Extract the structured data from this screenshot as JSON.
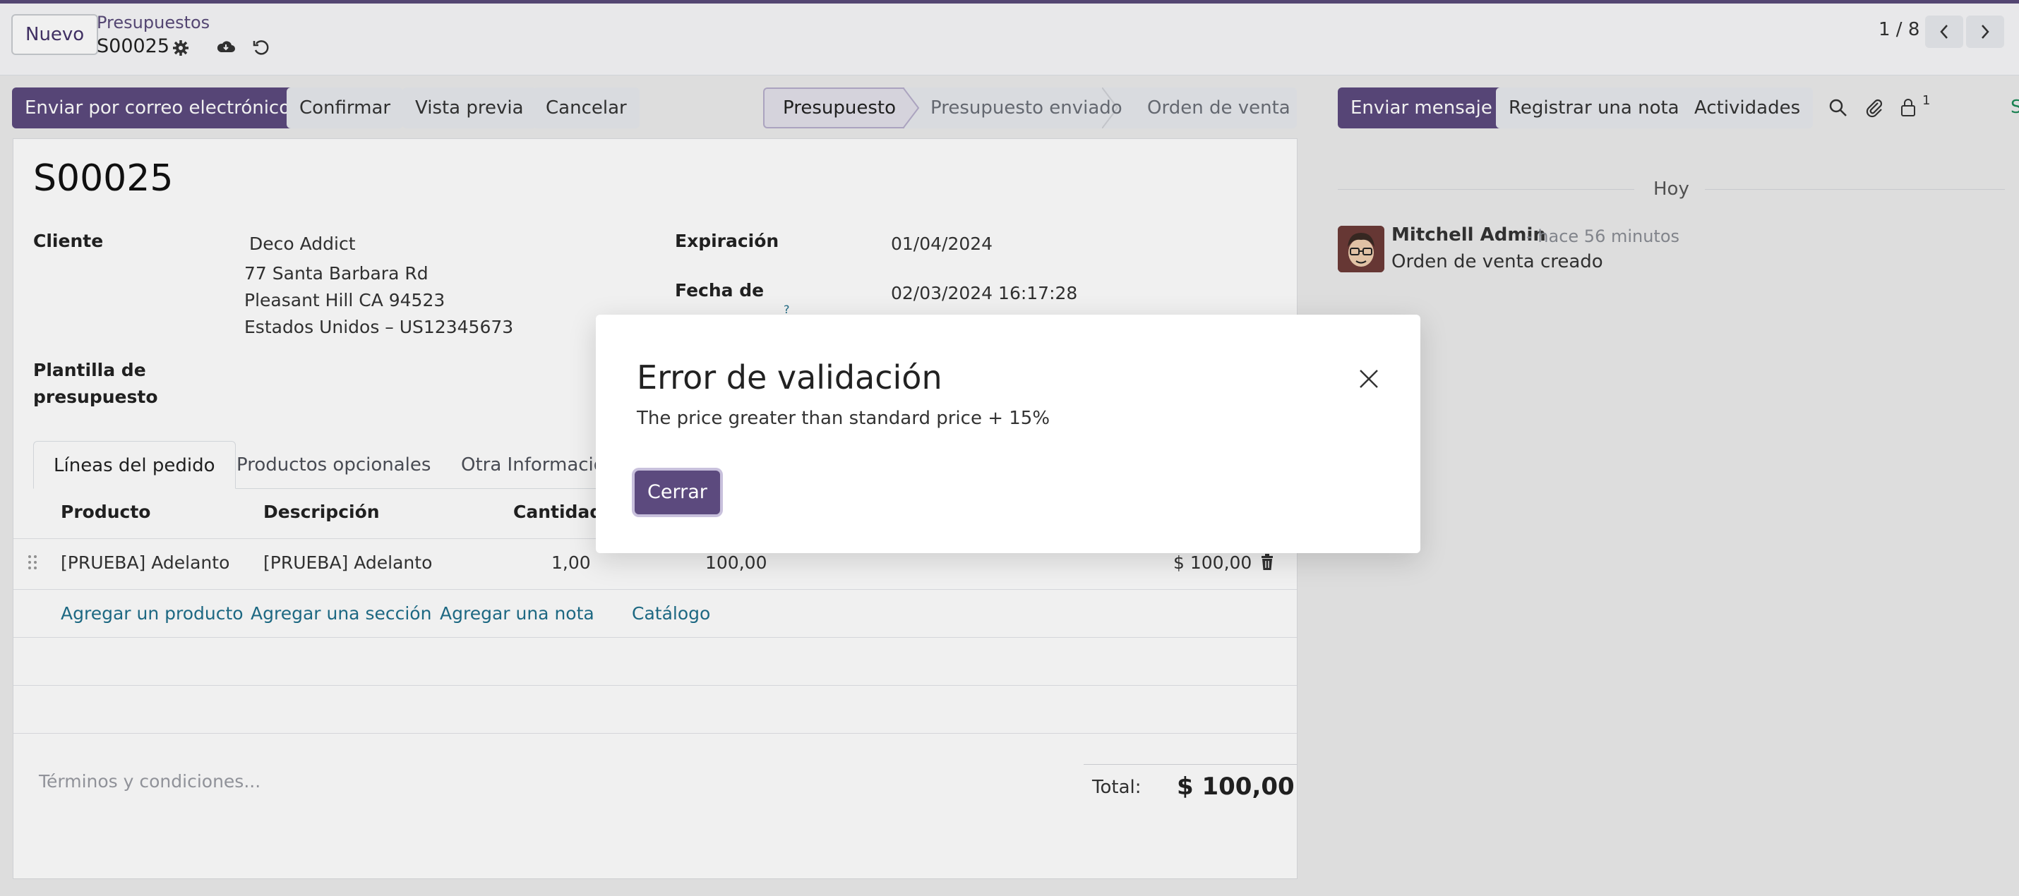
{
  "control_panel": {
    "new_button": "Nuevo",
    "breadcrumb_parent": "Presupuestos",
    "breadcrumb_current": "S00025",
    "pager": "1 / 8"
  },
  "actions": {
    "send_email": "Enviar por correo electrónico",
    "confirm": "Confirmar",
    "preview": "Vista previa",
    "cancel": "Cancelar"
  },
  "status": {
    "steps": [
      "Presupuesto",
      "Presupuesto enviado",
      "Orden de venta"
    ],
    "active": "Presupuesto"
  },
  "form": {
    "title": "S00025",
    "customer_label": "Cliente",
    "customer_name": "Deco Addict",
    "customer_address_1": "77 Santa Barbara Rd",
    "customer_address_2": "Pleasant Hill CA 94523",
    "customer_address_3": "Estados Unidos – US12345673",
    "template_label_1": "Plantilla de",
    "template_label_2": "presupuesto",
    "expiration_label": "Expiración",
    "expiration_value": "01/04/2024",
    "date_label": "Fecha de",
    "date_value": "02/03/2024 16:17:28",
    "help_mark": "?"
  },
  "tabs": [
    "Líneas del pedido",
    "Productos opcionales",
    "Otra Información"
  ],
  "table": {
    "headers": [
      "Producto",
      "Descripción",
      "Cantidad"
    ],
    "rows": [
      {
        "product": "[PRUEBA] Adelanto",
        "description": "[PRUEBA] Adelanto",
        "quantity": "1,00",
        "price": "100,00",
        "subtotal": "$ 100,00"
      }
    ],
    "add_links": [
      "Agregar un producto",
      "Agregar una sección",
      "Agregar una nota",
      "Catálogo"
    ]
  },
  "footer": {
    "terms_placeholder": "Términos y condiciones...",
    "total_label": "Total:",
    "total_value": "$ 100,00"
  },
  "chatter": {
    "send_message": "Enviar mensaje",
    "log_note": "Registrar una nota",
    "activities": "Actividades",
    "followers_count": "1",
    "today": "Hoy",
    "author": "Mitchell Admin",
    "time_ago": "- hace 56 minutos",
    "message": "Orden de venta creado"
  },
  "modal": {
    "title": "Error de validación",
    "body": "The price greater than standard price + 15%",
    "close_button": "Cerrar"
  },
  "colors": {
    "primary": "#5c4a7e",
    "link": "#1f6f8b"
  }
}
